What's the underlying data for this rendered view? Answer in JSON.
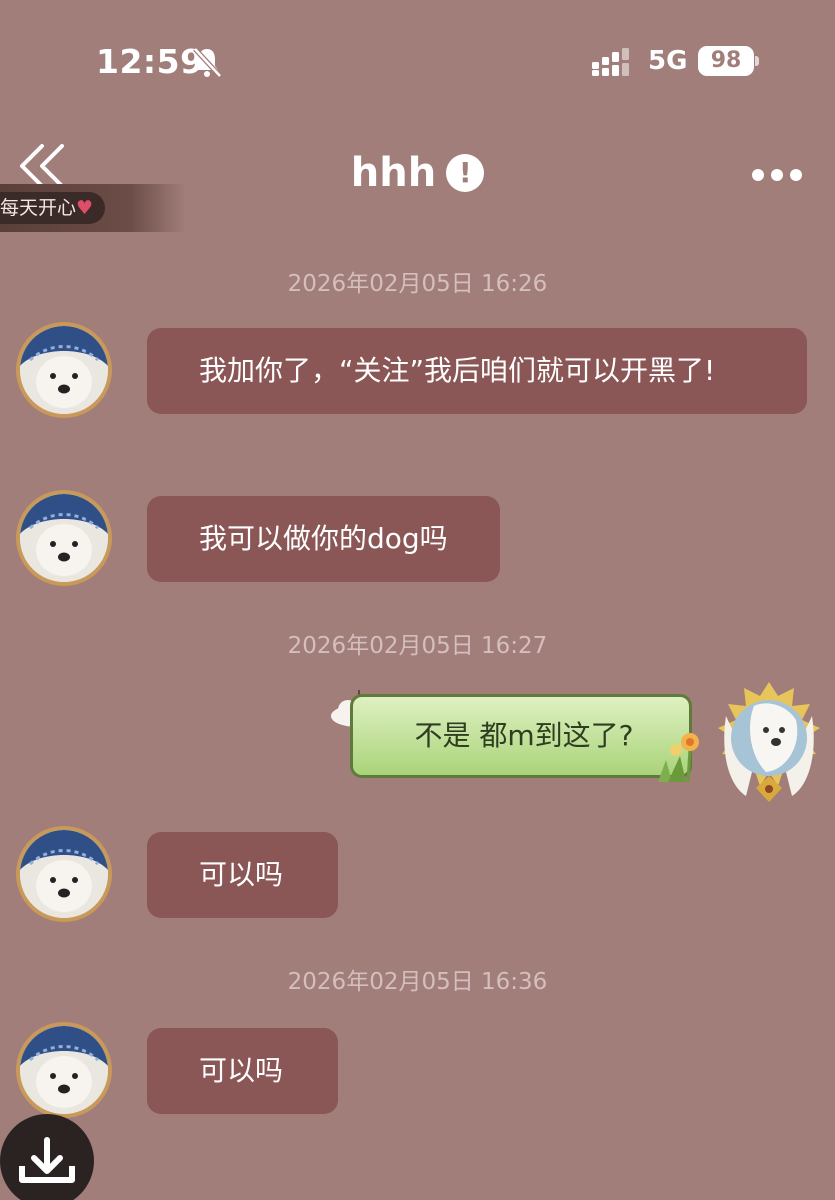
{
  "status_bar": {
    "time": "12:59",
    "network": "5G",
    "battery": "98"
  },
  "header": {
    "title": "hhh",
    "warning_symbol": "!",
    "mood_text": "每天开心"
  },
  "icons": [
    "bell-muted-icon",
    "signal-icon",
    "back-double-chevron-icon",
    "warning-icon",
    "more-dots-icon",
    "heart-icon",
    "download-icon"
  ],
  "colors": {
    "background": "#a27e7b",
    "incoming_bubble": "#8a5656",
    "outgoing_bubble": "#b8dc8c",
    "avatar_ring": "#c8995a"
  },
  "messages": [
    {
      "timestamp": "2026年02月05日 16:26"
    },
    {
      "sender": "other",
      "text": "我加你了，“关注”我后咱们就可以开黑了!"
    },
    {
      "sender": "other",
      "text": "我可以做你的dog吗"
    },
    {
      "timestamp": "2026年02月05日 16:27"
    },
    {
      "sender": "me",
      "text": "不是 都m到这了?"
    },
    {
      "sender": "other",
      "text": "可以吗"
    },
    {
      "timestamp": "2026年02月05日 16:36"
    },
    {
      "sender": "other",
      "text": "可以吗"
    }
  ]
}
